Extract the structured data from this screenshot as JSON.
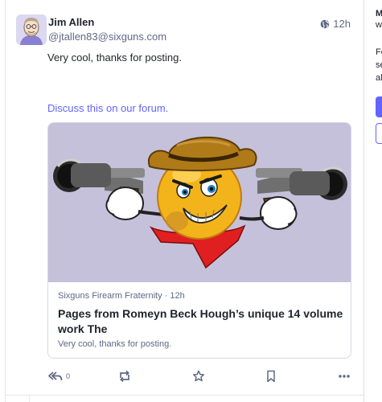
{
  "post": {
    "author": {
      "display_name": "Jim Allen",
      "handle": "@jtallen83@sixguns.com"
    },
    "timestamp": "12h",
    "visibility_icon": "globe-icon",
    "content": "Very cool, thanks for posting.",
    "link_text": "Discuss this on our forum.",
    "card": {
      "meta": "Sixguns Firearm Fraternity · 12h",
      "title": "Pages from Romeyn Beck Hough’s unique 14 volume work The",
      "description": "Very cool, thanks for posting.",
      "image_alt": "cowboy emoji holding two revolvers"
    },
    "actions": {
      "reply_icon": "reply-all-icon",
      "reply_count": "0",
      "boost_icon": "boost-icon",
      "favourite_icon": "star-icon",
      "bookmark_icon": "bookmark-icon",
      "more_icon": "more-icon"
    }
  },
  "sidebar": {
    "line1": "M",
    "line2": "w",
    "line3": "Fo",
    "line4": "se",
    "line5": "al"
  },
  "colors": {
    "accent": "#6364ff",
    "muted_text": "#606984",
    "card_image_bg": "#c5c1db"
  }
}
